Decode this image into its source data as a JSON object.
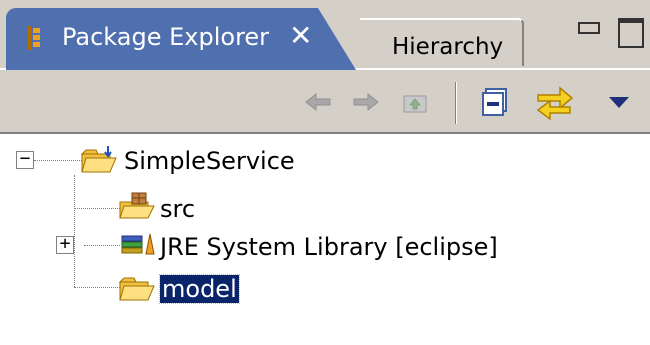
{
  "view": {
    "tab_active_label": "Package Explorer",
    "tab_close_glyph": "✕",
    "tab_inactive_label": "Hierarchy"
  },
  "toolbar": {
    "icons": [
      "back-arrow-icon",
      "forward-arrow-icon",
      "up-folder-icon",
      "collapse-all-icon",
      "link-with-editor-icon",
      "view-menu-icon"
    ]
  },
  "tree": {
    "project": {
      "label": "SimpleService",
      "expander": "−"
    },
    "src": {
      "label": "src"
    },
    "jre": {
      "label": "JRE System Library [eclipse]",
      "expander": "+"
    },
    "model": {
      "label": "model"
    }
  },
  "colors": {
    "active_tab": "#4f6fae",
    "chrome": "#d4d0c8",
    "selection": "#0a246a",
    "folder": "#f0c040"
  }
}
